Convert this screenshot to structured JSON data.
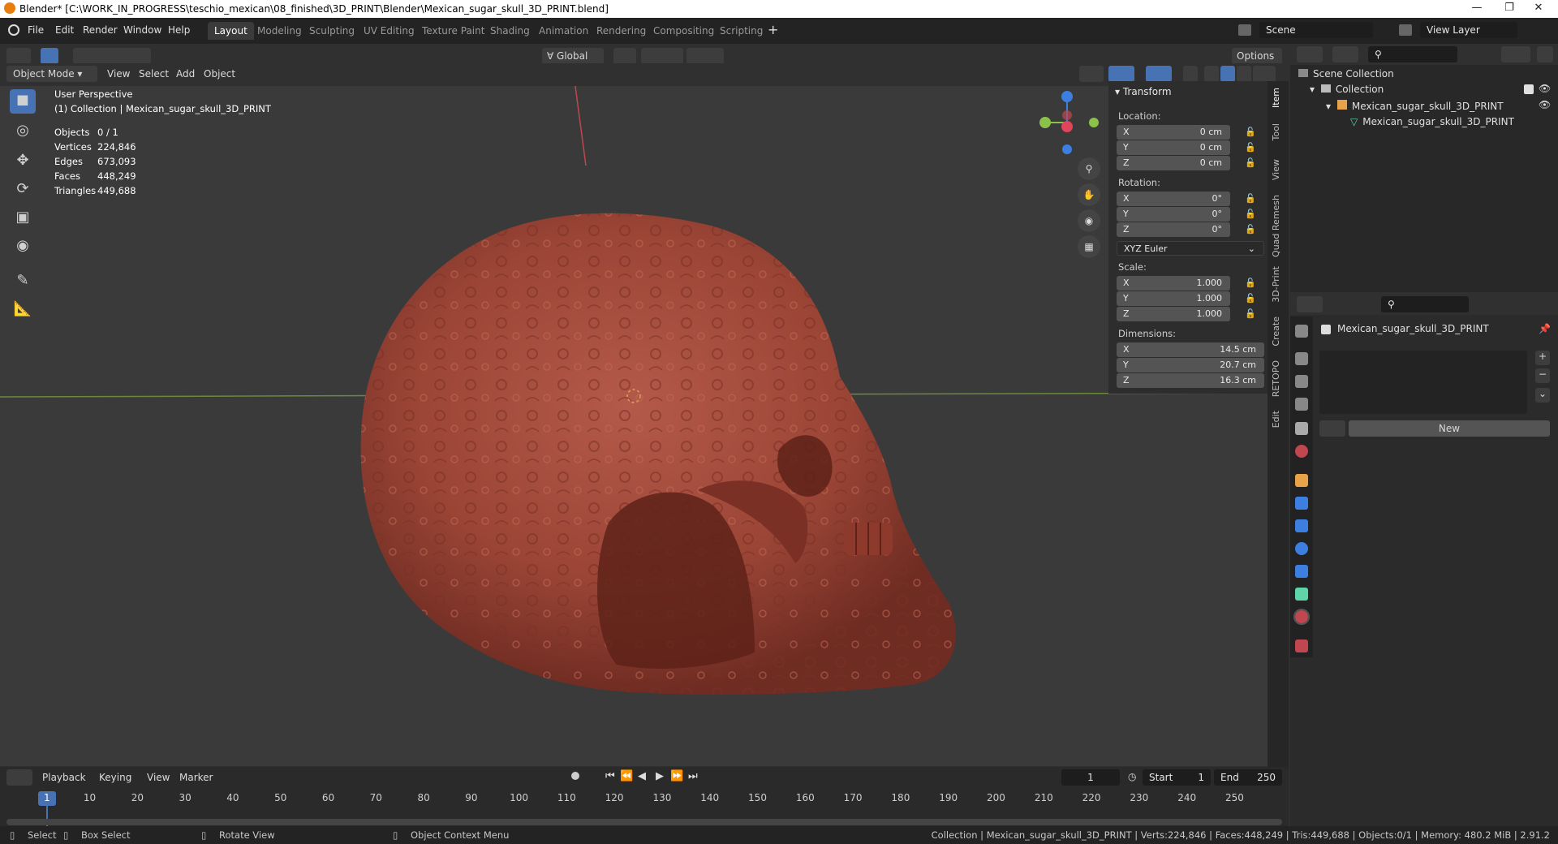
{
  "window": {
    "title": "Blender* [C:\\WORK_IN_PROGRESS\\teschio_mexican\\08_finished\\3D_PRINT\\Blender\\Mexican_sugar_skull_3D_PRINT.blend]"
  },
  "menu": [
    "File",
    "Edit",
    "Render",
    "Window",
    "Help"
  ],
  "workspaces": [
    "Layout",
    "Modeling",
    "Sculpting",
    "UV Editing",
    "Texture Paint",
    "Shading",
    "Animation",
    "Rendering",
    "Compositing",
    "Scripting"
  ],
  "active_workspace": "Layout",
  "scene_field": "Scene",
  "view_layer_field": "View Layer",
  "viewport_header": {
    "mode": "Object Mode",
    "menus": [
      "View",
      "Select",
      "Add",
      "Object"
    ],
    "transform_orientation": "Global",
    "options_label": "Options"
  },
  "overlay": {
    "perspective": "User Perspective",
    "collection_line": "(1) Collection | Mexican_sugar_skull_3D_PRINT",
    "stats": [
      {
        "label": "Objects",
        "value": "0 / 1"
      },
      {
        "label": "Vertices",
        "value": "224,846"
      },
      {
        "label": "Edges",
        "value": "673,093"
      },
      {
        "label": "Faces",
        "value": "448,249"
      },
      {
        "label": "Triangles",
        "value": "449,688"
      }
    ]
  },
  "npanel": {
    "section": "Transform",
    "location_label": "Location:",
    "location": [
      {
        "axis": "X",
        "value": "0 cm"
      },
      {
        "axis": "Y",
        "value": "0 cm"
      },
      {
        "axis": "Z",
        "value": "0 cm"
      }
    ],
    "rotation_label": "Rotation:",
    "rotation": [
      {
        "axis": "X",
        "value": "0°"
      },
      {
        "axis": "Y",
        "value": "0°"
      },
      {
        "axis": "Z",
        "value": "0°"
      }
    ],
    "rotation_mode": "XYZ Euler",
    "scale_label": "Scale:",
    "scale": [
      {
        "axis": "X",
        "value": "1.000"
      },
      {
        "axis": "Y",
        "value": "1.000"
      },
      {
        "axis": "Z",
        "value": "1.000"
      }
    ],
    "dimensions_label": "Dimensions:",
    "dimensions": [
      {
        "axis": "X",
        "value": "14.5 cm"
      },
      {
        "axis": "Y",
        "value": "20.7 cm"
      },
      {
        "axis": "Z",
        "value": "16.3 cm"
      }
    ]
  },
  "sidebar_tabs": [
    "Item",
    "Tool",
    "View",
    "Quad Remesh",
    "3D-Print",
    "Create",
    "RETOPO",
    "Edit"
  ],
  "outliner": {
    "rows": [
      "Scene Collection",
      "Collection",
      "Mexican_sugar_skull_3D_PRINT",
      "Mexican_sugar_skull_3D_PRINT"
    ]
  },
  "properties": {
    "object_name": "Mexican_sugar_skull_3D_PRINT",
    "new_button": "New"
  },
  "timeline": {
    "menus": [
      "Playback",
      "Keying",
      "View",
      "Marker"
    ],
    "current_frame": "1",
    "start_label": "Start",
    "start": "1",
    "end_label": "End",
    "end": "250",
    "ticks": [
      "1",
      "10",
      "20",
      "30",
      "40",
      "50",
      "60",
      "70",
      "80",
      "90",
      "100",
      "110",
      "120",
      "130",
      "140",
      "150",
      "160",
      "170",
      "180",
      "190",
      "200",
      "210",
      "220",
      "230",
      "240",
      "250"
    ]
  },
  "statusbar": {
    "select": "Select",
    "box_select": "Box Select",
    "rotate_view": "Rotate View",
    "context_menu": "Object Context Menu",
    "stats": "Collection | Mexican_sugar_skull_3D_PRINT | Verts:224,846 | Faces:448,249 | Tris:449,688 | Objects:0/1 | Memory: 480.2 MiB | 2.91.2"
  },
  "colors": {
    "accent": "#4772b3",
    "skull": "#a64a3c",
    "x_axis": "#e0455a",
    "y_axis": "#8bc34a",
    "z_axis": "#3d7fe0"
  }
}
